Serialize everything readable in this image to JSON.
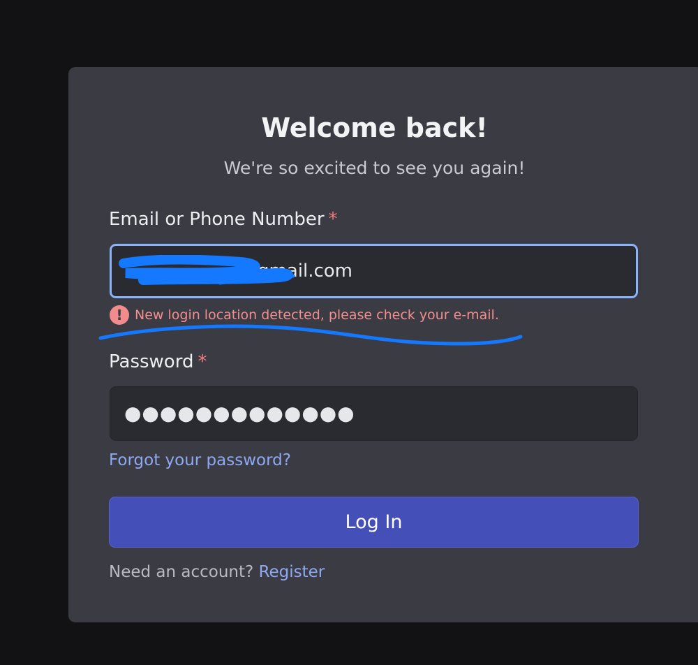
{
  "login": {
    "title": "Welcome back!",
    "subtitle": "We're so excited to see you again!",
    "email_label": "Email or Phone Number",
    "required_mark": "*",
    "email_value": "@gmail.com",
    "error_icon": "!",
    "error_message": "New login location detected, please check your e-mail.",
    "password_label": "Password",
    "password_mask": "●●●●●●●●●●●●●",
    "forgot_link": "Forgot your password?",
    "login_button": "Log In",
    "need_account": "Need an account?",
    "register_link": "Register"
  },
  "colors": {
    "background": "#121214",
    "card": "#3b3c43",
    "accent": "#4450b8",
    "link": "#8fa8f2",
    "error": "#f38d8f",
    "focus_border": "#8ab4f8",
    "redaction_scribble": "#1479ff"
  }
}
